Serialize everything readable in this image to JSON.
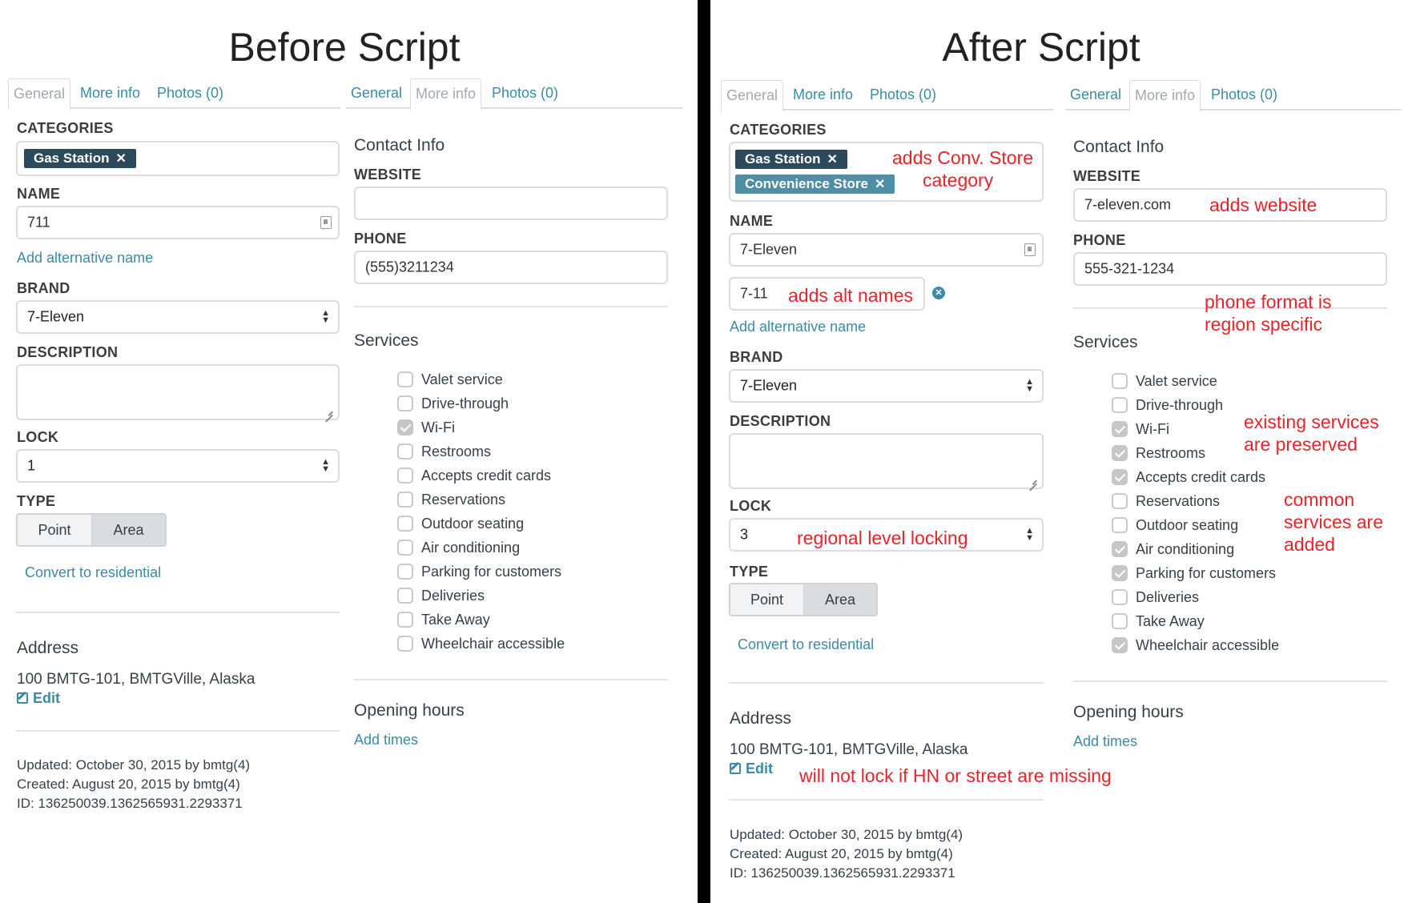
{
  "titles": {
    "before": "Before Script",
    "after": "After Script"
  },
  "tabs": {
    "general": "General",
    "more_info": "More info",
    "photos": "Photos (0)"
  },
  "labels": {
    "categories": "CATEGORIES",
    "name": "NAME",
    "brand": "BRAND",
    "description": "DESCRIPTION",
    "lock": "LOCK",
    "type": "TYPE",
    "website": "WEBSITE",
    "phone": "PHONE",
    "contact_info": "Contact Info",
    "services": "Services",
    "address": "Address",
    "opening_hours": "Opening hours",
    "add_times": "Add times",
    "add_alt_name": "Add alternative name",
    "convert": "Convert to residential",
    "point": "Point",
    "area": "Area",
    "edit": "Edit",
    "remove": "✕"
  },
  "before": {
    "categories": [
      "Gas Station"
    ],
    "name": "711",
    "brand": "7-Eleven",
    "lock": "1",
    "website": "",
    "phone": "(555)3211234",
    "address": "100 BMTG-101, BMTGVille, Alaska",
    "meta": {
      "updated": "Updated: October 30, 2015 by bmtg(4)",
      "created": "Created: August 20, 2015 by bmtg(4)",
      "id": "ID: 136250039.1362565931.2293371"
    }
  },
  "after": {
    "categories": [
      "Gas Station",
      "Convenience Store"
    ],
    "name": "7-Eleven",
    "alt_name": "7-11",
    "brand": "7-Eleven",
    "lock": "3",
    "website": "7-eleven.com",
    "phone": "555-321-1234",
    "address": "100 BMTG-101, BMTGVille, Alaska",
    "meta": {
      "updated": "Updated: October 30, 2015 by bmtg(4)",
      "created": "Created: August 20, 2015 by bmtg(4)",
      "id": "ID: 136250039.1362565931.2293371"
    }
  },
  "services": [
    {
      "label": "Valet service",
      "before": false,
      "after": false
    },
    {
      "label": "Drive-through",
      "before": false,
      "after": false
    },
    {
      "label": "Wi-Fi",
      "before": true,
      "after": true
    },
    {
      "label": "Restrooms",
      "before": false,
      "after": true
    },
    {
      "label": "Accepts credit cards",
      "before": false,
      "after": true
    },
    {
      "label": "Reservations",
      "before": false,
      "after": false
    },
    {
      "label": "Outdoor seating",
      "before": false,
      "after": false
    },
    {
      "label": "Air conditioning",
      "before": false,
      "after": true
    },
    {
      "label": "Parking for customers",
      "before": false,
      "after": true
    },
    {
      "label": "Deliveries",
      "before": false,
      "after": false
    },
    {
      "label": "Take Away",
      "before": false,
      "after": false
    },
    {
      "label": "Wheelchair accessible",
      "before": false,
      "after": true
    }
  ],
  "notes": {
    "category_1": "adds Conv. Store",
    "category_2": "category",
    "alt_names": "adds alt names",
    "lock": "regional level locking",
    "address": "will not lock if HN or street are missing",
    "website": "adds website",
    "phone_1": "phone format is",
    "phone_2": "region specific",
    "existing_1": "existing services",
    "existing_2": "are preserved",
    "common_1": "common",
    "common_2": "services are",
    "common_3": "added"
  }
}
